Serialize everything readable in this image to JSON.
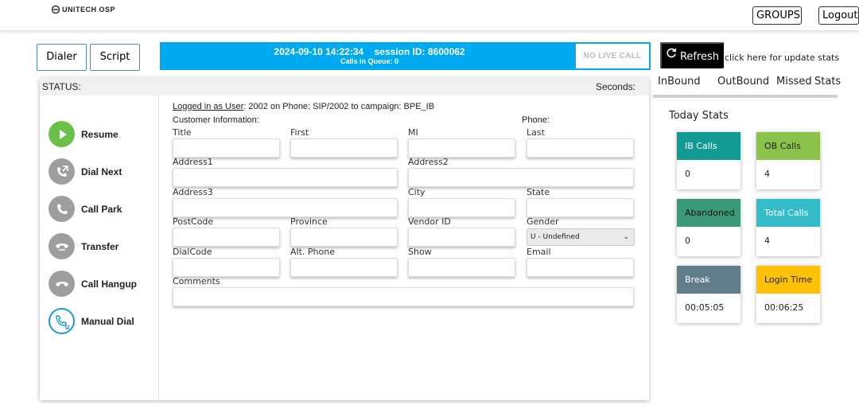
{
  "brand": {
    "logo_text": "UNITECH OSP"
  },
  "header": {
    "groups_label": "GROUPS",
    "logout_label": "Logout"
  },
  "nav": {
    "dialer_label": "Dialer",
    "script_label": "Script"
  },
  "infobar": {
    "datetime": "2024-09-10 14:22:34",
    "session_label": "session ID:",
    "session_id": "8600062",
    "queue_label": "Calls in Queue:",
    "queue_count": "0",
    "call_status": "NO LIVE CALL",
    "color": "#00aaf0"
  },
  "refresh": {
    "label": "Refresh",
    "hint": "click here for update stats"
  },
  "status": {
    "status_label": "STATUS:",
    "seconds_label": "Seconds:"
  },
  "actions": [
    {
      "label": "Resume",
      "icon": "play-icon",
      "color": "#6cc04a"
    },
    {
      "label": "Dial Next",
      "icon": "phone-outgoing-icon",
      "color": "#9e9e9e"
    },
    {
      "label": "Call Park",
      "icon": "phone-icon",
      "color": "#9e9e9e"
    },
    {
      "label": "Transfer",
      "icon": "transfer-icon",
      "color": "#9e9e9e"
    },
    {
      "label": "Call Hangup",
      "icon": "hangup-icon",
      "color": "#9e9e9e"
    },
    {
      "label": "Manual Dial",
      "icon": "manual-dial-icon",
      "color": "#1a9bd7"
    }
  ],
  "session_info": {
    "logged_in_label": "Logged in as User",
    "user": "2002",
    "phone_label": "on Phone:",
    "phone": "SIP/2002",
    "campaign_label": "to campaign:",
    "campaign": "BPE_IB",
    "customer_info_label": "Customer Information:",
    "phone_field_label": "Phone:"
  },
  "form": {
    "title": "Title",
    "first": "First",
    "mi": "MI",
    "last": "Last",
    "address1": "Address1",
    "address2": "Address2",
    "address3": "Address3",
    "city": "City",
    "state": "State",
    "postcode": "PostCode",
    "province": "Province",
    "vendor_id": "Vendor ID",
    "gender": "Gender",
    "gender_value": "U - Undefined",
    "dialcode": "DialCode",
    "alt_phone": "Alt. Phone",
    "show": "Show",
    "email": "Email",
    "comments": "Comments"
  },
  "stats": {
    "tabs": [
      "InBound",
      "OutBound",
      "Missed",
      "Stats"
    ],
    "today_label": "Today Stats",
    "cards": [
      {
        "label": "IB Calls",
        "value": "0",
        "color": "#129b94"
      },
      {
        "label": "OB Calls",
        "value": "4",
        "color": "#8bc34a"
      },
      {
        "label": "Abandoned",
        "value": "0",
        "color": "#3a9a78"
      },
      {
        "label": "Total Calls",
        "value": "4",
        "color": "#35bcc9"
      },
      {
        "label": "Break",
        "value": "00:05:05",
        "color": "#607d8b"
      },
      {
        "label": "Login Time",
        "value": "00:06:25",
        "color": "#ffc107"
      }
    ]
  }
}
